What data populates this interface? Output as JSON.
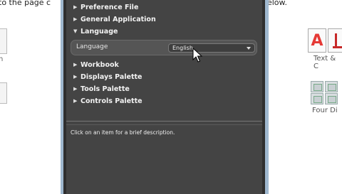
{
  "background_doc": {
    "line_left": "to the page c",
    "line_right": "below.",
    "left_partial_label": "n",
    "icon_a_glyph": "A",
    "text_tools_label": "Text & C",
    "four_label": "Four Di"
  },
  "tree": {
    "items": [
      {
        "label": "Preference File",
        "expanded": false
      },
      {
        "label": "General Application",
        "expanded": false
      },
      {
        "label": "Language",
        "expanded": true
      },
      {
        "label": "Workbook",
        "expanded": false
      },
      {
        "label": "Displays Palette",
        "expanded": false
      },
      {
        "label": "Tools Palette",
        "expanded": false
      },
      {
        "label": "Controls Palette",
        "expanded": false
      }
    ]
  },
  "language_setting": {
    "label": "Language",
    "selected": "English"
  },
  "description": {
    "text": "Click on an item for a brief description."
  },
  "colors": {
    "dialog_bg": "#444444",
    "dialog_border": "#9fb8cf",
    "text": "#f2f2f2",
    "icon_red": "#e53935"
  }
}
